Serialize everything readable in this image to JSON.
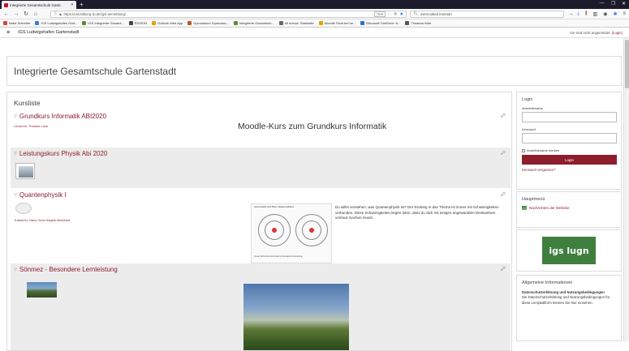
{
  "browser": {
    "tab_title": "Integrierte Gesamtschule Garte",
    "url": "https://ost.bildung-rp.de/igsl-anmeldung/",
    "zoom": "70%",
    "search_text": "overcooked ironman"
  },
  "bookmarks": [
    {
      "label": "Baba Schreiter",
      "color": "#d14b3b"
    },
    {
      "label": "IGS Ludwigshafen Gart...",
      "color": "#3b7cd1"
    },
    {
      "label": "IGS Integrierte Gesamt...",
      "color": "#5d8a3a"
    },
    {
      "label": "EDISON",
      "color": "#444444"
    },
    {
      "label": "Outlook Web App",
      "color": "#e2a400"
    },
    {
      "label": "Gymnasium Gymnasiu...",
      "color": "#b25d2a"
    },
    {
      "label": "Integrierte Gesamtsch...",
      "color": "#5d8a3a"
    },
    {
      "label": "inf schule: Startseite",
      "color": "#666666"
    },
    {
      "label": "Moodle Sicht bei he...",
      "color": "#e2a400"
    },
    {
      "label": "Microsoft OneDrive: A...",
      "color": "#2a6fd6"
    },
    {
      "label": "Timaena Web",
      "color": "#555555"
    }
  ],
  "site": {
    "name": "IGS Ludwigshafen Gartenstadt",
    "login_note": "Sie sind nicht angemeldet.",
    "login_link": "(Login)",
    "page_title": "Integrierte Gesamtschule Gartenstadt"
  },
  "kursliste": {
    "title": "Kursliste",
    "courses": [
      {
        "title": "Grundkurs Informatik ABI2020",
        "teacher": "Lehrer/in: Thomas Lück",
        "summary": "Moodle-Kurs zum Grundkurs Informatik"
      },
      {
        "title": "Leistungskurs Physik Abi 2020"
      },
      {
        "title": "Quantenphysik I",
        "teacher": "Trainer/in: Hans Gerd Hegele-Berkbold",
        "desc": "Du willst verstehen, was Quantenphysik ist? Der Einstieg in das Thema ist immer mit Schwierigkeiten verbunden. Diese Schwierigkeiten liegen darin, dass du dich mit einigen angewandten Denkweisen vertraut machen musst.",
        "diagram_title": "Atommodelle nach Bohr / Wasserstoffatom",
        "diagram_caption": "Quelle: Bohrsches Atommodell (schematische Darstellung)"
      },
      {
        "title": "Sönmez - Besondere Lernleistung"
      }
    ]
  },
  "login": {
    "title": "Login",
    "username_label": "Anmeldename",
    "password_label": "Kennwort",
    "remember_label": "Anmeldename merken",
    "button": "Login",
    "forgot": "Kennwort vergessen?"
  },
  "homepage": {
    "title": "Hauptmenü",
    "link": "Nachrichten der Website"
  },
  "logo_text": "igs lugn",
  "info": {
    "title": "Allgemeine Informationen",
    "heading": "Datenschutzerklärung und Nutzungsbedingungen",
    "text": "Die Datenschutzerklärung und Nutzungsbedingungen für diese Lernplattform können Sie hier einsehen."
  }
}
